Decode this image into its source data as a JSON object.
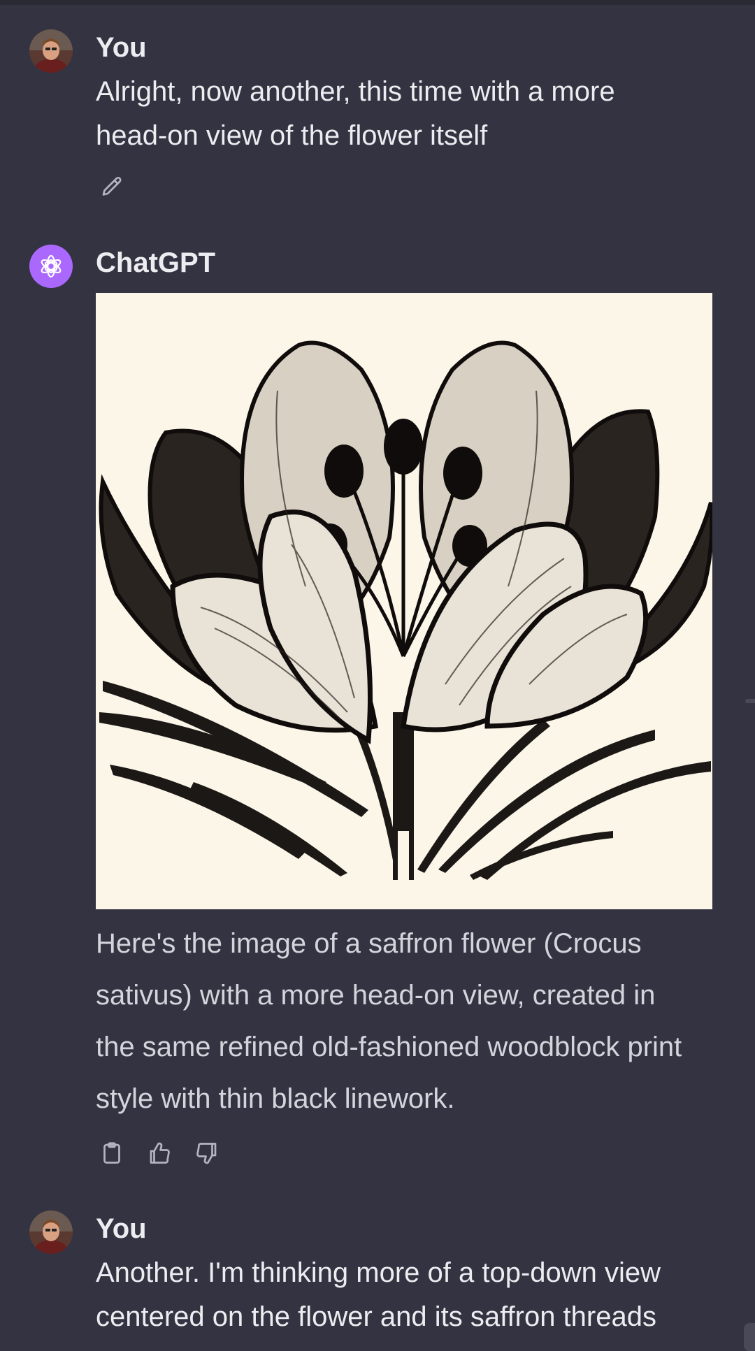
{
  "messages": [
    {
      "role": "user",
      "author": "You",
      "text": "Alright, now another, this time with a more head-on view of the flower itself",
      "actions": [
        "edit-icon"
      ]
    },
    {
      "role": "assistant",
      "author": "ChatGPT",
      "image_alt": "saffron flower woodblock print",
      "text": "Here's the image of a saffron flower (Crocus sativus) with a more head-on view, created in the same refined old-fashioned woodblock print style with thin black linework.",
      "actions": [
        "clipboard-icon",
        "thumbs-up-icon",
        "thumbs-down-icon"
      ]
    },
    {
      "role": "user",
      "author": "You",
      "text": "Another.  I'm thinking more of a top-down view centered on the flower and its saffron threads"
    }
  ],
  "colors": {
    "background": "#343341",
    "text": "#ececf1",
    "assistant_avatar": "#ab68ff",
    "image_background": "#fbf6e8"
  }
}
